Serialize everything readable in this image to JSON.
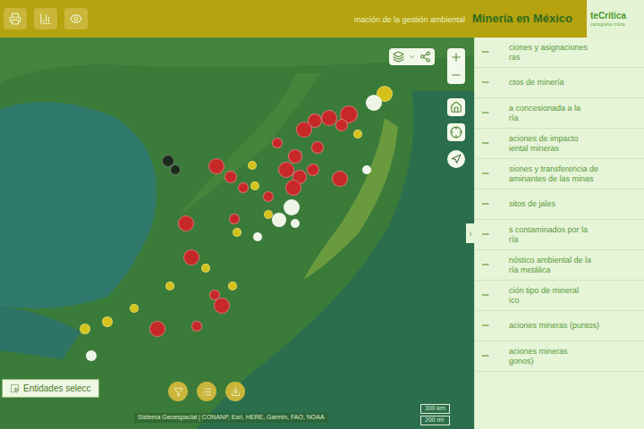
{
  "header": {
    "logo": "teCrítica",
    "logo_sub": "cartografía crítica",
    "title": "Minería en México",
    "subtitle": "mación de la gestión ambiental"
  },
  "sidebar": {
    "collapse": "›",
    "more": "•••",
    "items": [
      {
        "lines": [
          "ciones y asignaciones",
          "ras"
        ]
      },
      {
        "lines": [
          "ctos de minería"
        ]
      },
      {
        "lines": [
          "a concesionada a la",
          "ría"
        ]
      },
      {
        "lines": [
          "aciones de impacto",
          "iental mineras"
        ]
      },
      {
        "lines": [
          "siones y transferencia de",
          "aminantes de las minas"
        ]
      },
      {
        "lines": [
          "sitos de jales"
        ]
      },
      {
        "lines": [
          "s contaminados por la",
          "ría"
        ]
      },
      {
        "lines": [
          "nóstico ambiental de la",
          "ría metálica"
        ]
      },
      {
        "lines": [
          "ción tipo de mineral",
          "ico"
        ]
      },
      {
        "lines": [
          "aciones mineras (puntos)"
        ]
      },
      {
        "lines": [
          "aciones mineras",
          "gonos)"
        ]
      }
    ]
  },
  "map": {
    "selection_button": "Entidades selecc",
    "attribution": "Sistema Geoespacial | CONANP, Esri, HERE, Garmin, FAO, NOAA",
    "scale": [
      "300 km",
      "200 mi"
    ],
    "markers": [
      {
        "color": "#c62828"
      },
      {
        "color": "#c62828"
      },
      {
        "color": "#c62828"
      },
      {
        "color": "#c62828"
      },
      {
        "color": "#c62828"
      },
      {
        "color": "#c62828"
      },
      {
        "color": "#c62828"
      },
      {
        "color": "#c62828"
      },
      {
        "color": "#c62828"
      },
      {
        "color": "#c62828"
      },
      {
        "color": "#c62828"
      },
      {
        "color": "#c62828"
      },
      {
        "color": "#c62828"
      },
      {
        "color": "#c62828"
      },
      {
        "color": "#c62828"
      },
      {
        "color": "#c62828"
      },
      {
        "color": "#c62828"
      },
      {
        "color": "#c62828"
      },
      {
        "color": "#c62828"
      },
      {
        "color": "#c62828"
      },
      {
        "color": "#d4c21a"
      },
      {
        "color": "#d4c21a"
      },
      {
        "color": "#d4c21a"
      },
      {
        "color": "#d4c21a"
      },
      {
        "color": "#d4c21a"
      },
      {
        "color": "#d4c21a"
      },
      {
        "color": "#d4c21a"
      },
      {
        "color": "#d4c21a"
      },
      {
        "color": "#d4c21a"
      },
      {
        "color": "#d4c21a"
      },
      {
        "color": "#eef5e6"
      },
      {
        "color": "#eef5e6"
      },
      {
        "color": "#eef5e6"
      },
      {
        "color": "#eef5e6"
      },
      {
        "color": "#eef5e6"
      },
      {
        "color": "#eef5e6"
      },
      {
        "color": "#1c2a1c"
      },
      {
        "color": "#1c2a1c"
      },
      {
        "color": "#c62828"
      },
      {
        "color": "#c62828"
      },
      {
        "color": "#d4c21a"
      },
      {
        "color": "#d4c21a"
      },
      {
        "color": "#c62828"
      },
      {
        "color": "#eef5e6"
      },
      {
        "color": "#c62828"
      }
    ]
  }
}
